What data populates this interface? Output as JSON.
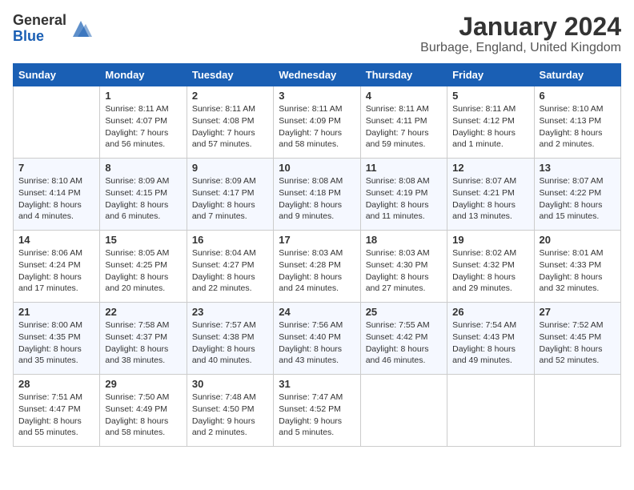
{
  "header": {
    "logo_general": "General",
    "logo_blue": "Blue",
    "month": "January 2024",
    "location": "Burbage, England, United Kingdom"
  },
  "days_of_week": [
    "Sunday",
    "Monday",
    "Tuesday",
    "Wednesday",
    "Thursday",
    "Friday",
    "Saturday"
  ],
  "weeks": [
    [
      {
        "day": "",
        "info": ""
      },
      {
        "day": "1",
        "info": "Sunrise: 8:11 AM\nSunset: 4:07 PM\nDaylight: 7 hours\nand 56 minutes."
      },
      {
        "day": "2",
        "info": "Sunrise: 8:11 AM\nSunset: 4:08 PM\nDaylight: 7 hours\nand 57 minutes."
      },
      {
        "day": "3",
        "info": "Sunrise: 8:11 AM\nSunset: 4:09 PM\nDaylight: 7 hours\nand 58 minutes."
      },
      {
        "day": "4",
        "info": "Sunrise: 8:11 AM\nSunset: 4:11 PM\nDaylight: 7 hours\nand 59 minutes."
      },
      {
        "day": "5",
        "info": "Sunrise: 8:11 AM\nSunset: 4:12 PM\nDaylight: 8 hours\nand 1 minute."
      },
      {
        "day": "6",
        "info": "Sunrise: 8:10 AM\nSunset: 4:13 PM\nDaylight: 8 hours\nand 2 minutes."
      }
    ],
    [
      {
        "day": "7",
        "info": "Sunrise: 8:10 AM\nSunset: 4:14 PM\nDaylight: 8 hours\nand 4 minutes."
      },
      {
        "day": "8",
        "info": "Sunrise: 8:09 AM\nSunset: 4:15 PM\nDaylight: 8 hours\nand 6 minutes."
      },
      {
        "day": "9",
        "info": "Sunrise: 8:09 AM\nSunset: 4:17 PM\nDaylight: 8 hours\nand 7 minutes."
      },
      {
        "day": "10",
        "info": "Sunrise: 8:08 AM\nSunset: 4:18 PM\nDaylight: 8 hours\nand 9 minutes."
      },
      {
        "day": "11",
        "info": "Sunrise: 8:08 AM\nSunset: 4:19 PM\nDaylight: 8 hours\nand 11 minutes."
      },
      {
        "day": "12",
        "info": "Sunrise: 8:07 AM\nSunset: 4:21 PM\nDaylight: 8 hours\nand 13 minutes."
      },
      {
        "day": "13",
        "info": "Sunrise: 8:07 AM\nSunset: 4:22 PM\nDaylight: 8 hours\nand 15 minutes."
      }
    ],
    [
      {
        "day": "14",
        "info": "Sunrise: 8:06 AM\nSunset: 4:24 PM\nDaylight: 8 hours\nand 17 minutes."
      },
      {
        "day": "15",
        "info": "Sunrise: 8:05 AM\nSunset: 4:25 PM\nDaylight: 8 hours\nand 20 minutes."
      },
      {
        "day": "16",
        "info": "Sunrise: 8:04 AM\nSunset: 4:27 PM\nDaylight: 8 hours\nand 22 minutes."
      },
      {
        "day": "17",
        "info": "Sunrise: 8:03 AM\nSunset: 4:28 PM\nDaylight: 8 hours\nand 24 minutes."
      },
      {
        "day": "18",
        "info": "Sunrise: 8:03 AM\nSunset: 4:30 PM\nDaylight: 8 hours\nand 27 minutes."
      },
      {
        "day": "19",
        "info": "Sunrise: 8:02 AM\nSunset: 4:32 PM\nDaylight: 8 hours\nand 29 minutes."
      },
      {
        "day": "20",
        "info": "Sunrise: 8:01 AM\nSunset: 4:33 PM\nDaylight: 8 hours\nand 32 minutes."
      }
    ],
    [
      {
        "day": "21",
        "info": "Sunrise: 8:00 AM\nSunset: 4:35 PM\nDaylight: 8 hours\nand 35 minutes."
      },
      {
        "day": "22",
        "info": "Sunrise: 7:58 AM\nSunset: 4:37 PM\nDaylight: 8 hours\nand 38 minutes."
      },
      {
        "day": "23",
        "info": "Sunrise: 7:57 AM\nSunset: 4:38 PM\nDaylight: 8 hours\nand 40 minutes."
      },
      {
        "day": "24",
        "info": "Sunrise: 7:56 AM\nSunset: 4:40 PM\nDaylight: 8 hours\nand 43 minutes."
      },
      {
        "day": "25",
        "info": "Sunrise: 7:55 AM\nSunset: 4:42 PM\nDaylight: 8 hours\nand 46 minutes."
      },
      {
        "day": "26",
        "info": "Sunrise: 7:54 AM\nSunset: 4:43 PM\nDaylight: 8 hours\nand 49 minutes."
      },
      {
        "day": "27",
        "info": "Sunrise: 7:52 AM\nSunset: 4:45 PM\nDaylight: 8 hours\nand 52 minutes."
      }
    ],
    [
      {
        "day": "28",
        "info": "Sunrise: 7:51 AM\nSunset: 4:47 PM\nDaylight: 8 hours\nand 55 minutes."
      },
      {
        "day": "29",
        "info": "Sunrise: 7:50 AM\nSunset: 4:49 PM\nDaylight: 8 hours\nand 58 minutes."
      },
      {
        "day": "30",
        "info": "Sunrise: 7:48 AM\nSunset: 4:50 PM\nDaylight: 9 hours\nand 2 minutes."
      },
      {
        "day": "31",
        "info": "Sunrise: 7:47 AM\nSunset: 4:52 PM\nDaylight: 9 hours\nand 5 minutes."
      },
      {
        "day": "",
        "info": ""
      },
      {
        "day": "",
        "info": ""
      },
      {
        "day": "",
        "info": ""
      }
    ]
  ]
}
